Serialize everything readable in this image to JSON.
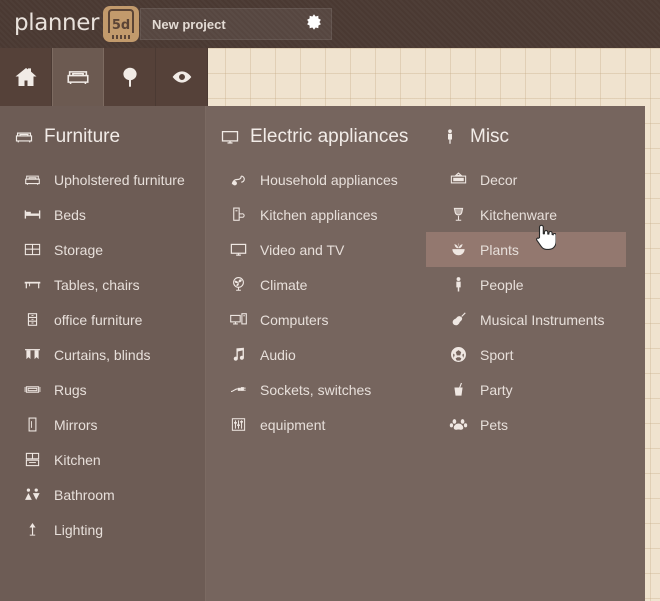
{
  "header": {
    "logo_word": "planner",
    "logo_badge": "5d",
    "project_name": "New project",
    "gear_icon": "gear-icon"
  },
  "tabs": [
    {
      "name": "tab-home",
      "icon": "house-icon",
      "active": false
    },
    {
      "name": "tab-furniture",
      "icon": "sofa-icon",
      "active": true
    },
    {
      "name": "tab-outdoor",
      "icon": "tree-icon",
      "active": false
    },
    {
      "name": "tab-view",
      "icon": "eye-icon",
      "active": false
    }
  ],
  "columns": [
    {
      "id": "furniture",
      "title": "Furniture",
      "icon": "sofa-icon",
      "items": [
        {
          "label": "Upholstered furniture",
          "icon": "sofa-icon",
          "selected": false
        },
        {
          "label": "Beds",
          "icon": "bed-icon",
          "selected": false
        },
        {
          "label": "Storage",
          "icon": "shelf-icon",
          "selected": false
        },
        {
          "label": "Tables, chairs",
          "icon": "table-icon",
          "selected": false
        },
        {
          "label": "office furniture",
          "icon": "drawers-icon",
          "selected": false
        },
        {
          "label": "Curtains, blinds",
          "icon": "curtain-icon",
          "selected": false
        },
        {
          "label": "Rugs",
          "icon": "rug-icon",
          "selected": false
        },
        {
          "label": "Mirrors",
          "icon": "mirror-icon",
          "selected": false
        },
        {
          "label": "Kitchen",
          "icon": "kitchen-cabinet-icon",
          "selected": false
        },
        {
          "label": "Bathroom",
          "icon": "bathroom-icon",
          "selected": false
        },
        {
          "label": "Lighting",
          "icon": "lamp-icon",
          "selected": false
        }
      ]
    },
    {
      "id": "electric",
      "title": "Electric appliances",
      "icon": "monitor-icon",
      "items": [
        {
          "label": "Household appliances",
          "icon": "vacuum-icon",
          "selected": false
        },
        {
          "label": "Kitchen appliances",
          "icon": "coffeemaker-icon",
          "selected": false
        },
        {
          "label": "Video and TV",
          "icon": "monitor-icon",
          "selected": false
        },
        {
          "label": "Climate",
          "icon": "fan-icon",
          "selected": false
        },
        {
          "label": "Computers",
          "icon": "computer-icon",
          "selected": false
        },
        {
          "label": "Audio",
          "icon": "music-note-icon",
          "selected": false
        },
        {
          "label": "Sockets, switches",
          "icon": "plug-icon",
          "selected": false
        },
        {
          "label": "equipment",
          "icon": "equalizer-icon",
          "selected": false
        }
      ]
    },
    {
      "id": "misc",
      "title": "Misc",
      "icon": "person-icon",
      "items": [
        {
          "label": "Decor",
          "icon": "picture-frame-icon",
          "selected": false
        },
        {
          "label": "Kitchenware",
          "icon": "wine-glass-icon",
          "selected": false
        },
        {
          "label": "Plants",
          "icon": "plant-icon",
          "selected": true
        },
        {
          "label": "People",
          "icon": "person-icon",
          "selected": false
        },
        {
          "label": "Musical Instruments",
          "icon": "guitar-icon",
          "selected": false
        },
        {
          "label": "Sport",
          "icon": "soccer-ball-icon",
          "selected": false
        },
        {
          "label": "Party",
          "icon": "drink-cup-icon",
          "selected": false
        },
        {
          "label": "Pets",
          "icon": "paw-icon",
          "selected": false
        }
      ]
    }
  ],
  "cursor": {
    "icon": "pointing-hand-cursor"
  },
  "colors": {
    "topbar": "#4b3a33",
    "panel": "#76655e",
    "panel_left_column": "#6d5c55",
    "tab_active": "#6c5a51",
    "tab_inactive": "#554139",
    "highlight": "#93786f",
    "canvas": "#f0e3cf",
    "logo_badge": "#c29a6c",
    "text": "#e7dfda"
  }
}
